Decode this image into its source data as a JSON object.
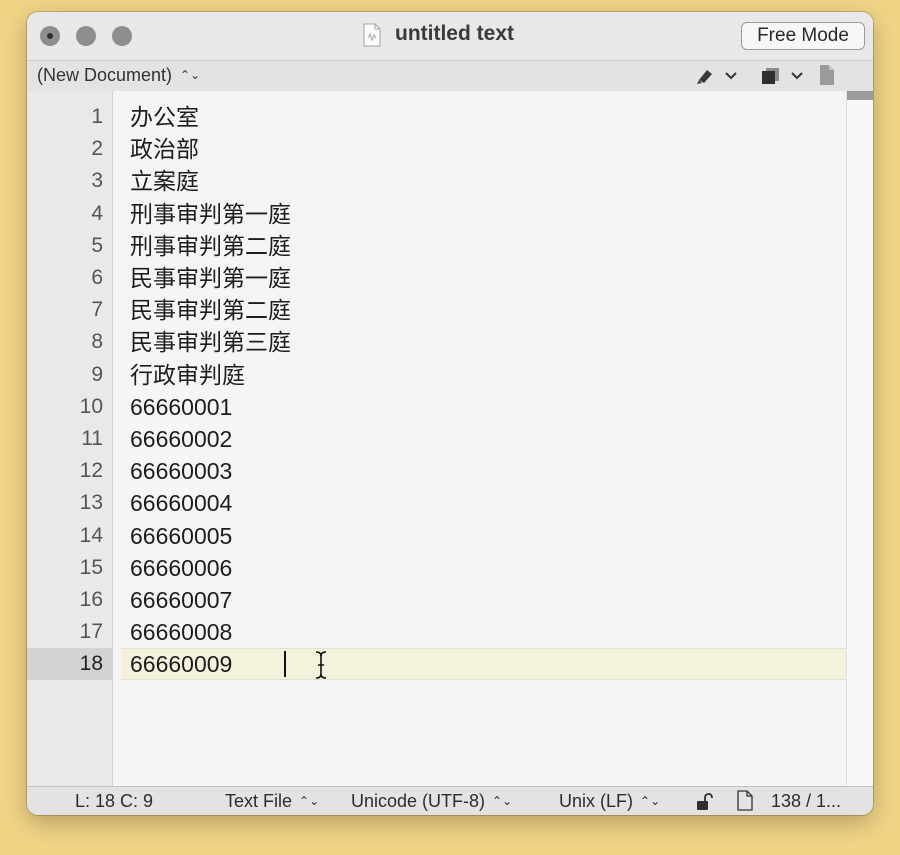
{
  "window": {
    "title": "untitled text",
    "mode_button": "Free Mode"
  },
  "toolbar": {
    "document_selector": "(New Document)",
    "icons": [
      "marker-pen-icon",
      "chevron-down-icon",
      "layers-icon",
      "chevron-down-icon",
      "document-icon"
    ]
  },
  "editor": {
    "current_line": 18,
    "lines": [
      {
        "number": "1",
        "text": "办公室"
      },
      {
        "number": "2",
        "text": "政治部"
      },
      {
        "number": "3",
        "text": "立案庭"
      },
      {
        "number": "4",
        "text": "刑事审判第一庭"
      },
      {
        "number": "5",
        "text": "刑事审判第二庭"
      },
      {
        "number": "6",
        "text": "民事审判第一庭"
      },
      {
        "number": "7",
        "text": "民事审判第二庭"
      },
      {
        "number": "8",
        "text": "民事审判第三庭"
      },
      {
        "number": "9",
        "text": "行政审判庭"
      },
      {
        "number": "10",
        "text": "66660001"
      },
      {
        "number": "11",
        "text": "66660002"
      },
      {
        "number": "12",
        "text": "66660003"
      },
      {
        "number": "13",
        "text": "66660004"
      },
      {
        "number": "14",
        "text": "66660005"
      },
      {
        "number": "15",
        "text": "66660006"
      },
      {
        "number": "16",
        "text": "66660007"
      },
      {
        "number": "17",
        "text": "66660008"
      },
      {
        "number": "18",
        "text": "66660009"
      }
    ]
  },
  "status": {
    "position": "L: 18 C: 9",
    "syntax": "Text File",
    "encoding": "Unicode (UTF-8)",
    "line_endings": "Unix (LF)",
    "count": "138 / 1..."
  },
  "colors": {
    "desktop": "#f1d486",
    "current_line_highlight": "#f4f2dc"
  }
}
